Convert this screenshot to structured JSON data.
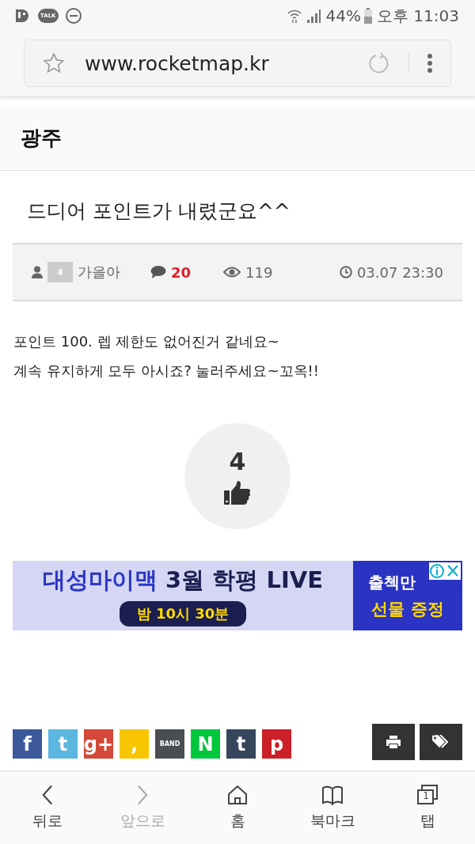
{
  "status_bar": {
    "battery": "44%",
    "time": "오후 11:03",
    "notification_icons": [
      "TALK"
    ]
  },
  "address_bar": {
    "url": "www.rocketmap.kr"
  },
  "board": {
    "title": "광주"
  },
  "post": {
    "title": "드디어 포인트가 내렸군요^^",
    "meta": {
      "level": "4",
      "author": "가을아",
      "comments": "20",
      "views": "119",
      "date": "03.07 23:30"
    },
    "body": [
      "포인트 100. 렙 제한도 없어진거 같네요~",
      "계속 유지하게 모두 아시죠? 눌러주세요~꼬옥!!"
    ],
    "likes": "4"
  },
  "ad": {
    "headline_part1": "대성마이맥",
    "headline_part2": "3월 학평 LIVE",
    "time_pill": "밤 10시 30분",
    "side_line1": "출첵만",
    "side_line2": "선물 증정"
  },
  "share_buttons": [
    {
      "glyph": "f",
      "color": "#3b5998"
    },
    {
      "glyph": "t",
      "color": "#5bb6e0"
    },
    {
      "glyph": "g+",
      "color": "#d34836"
    },
    {
      "glyph": ",",
      "color": "#f7c600"
    },
    {
      "glyph": "BAND",
      "color": "#4a4d52"
    },
    {
      "glyph": "N",
      "color": "#00c73c"
    },
    {
      "glyph": "t",
      "color": "#35465c"
    },
    {
      "glyph": "p",
      "color": "#cb2027"
    }
  ],
  "bottom_nav": [
    {
      "label": "뒤로",
      "kind": "back",
      "disabled": false
    },
    {
      "label": "앞으로",
      "kind": "forward",
      "disabled": true
    },
    {
      "label": "홈",
      "kind": "home",
      "disabled": false
    },
    {
      "label": "북마크",
      "kind": "bookmark",
      "disabled": false
    },
    {
      "label": "탭",
      "kind": "tabs",
      "disabled": false,
      "count": "1"
    }
  ]
}
